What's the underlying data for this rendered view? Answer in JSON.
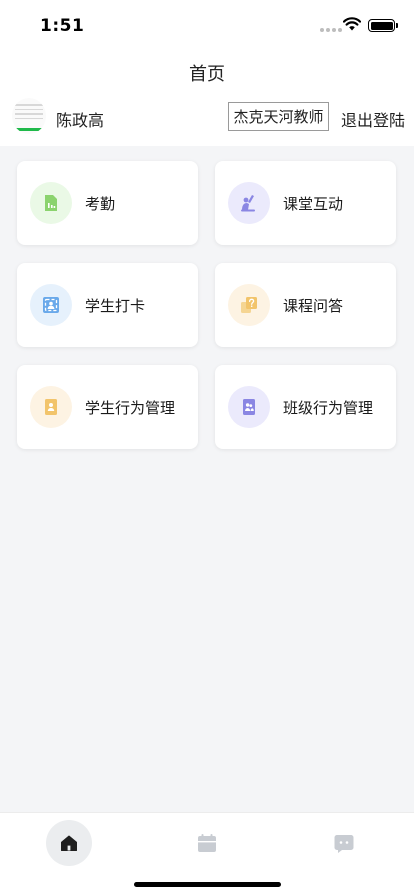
{
  "status": {
    "time": "1:51"
  },
  "nav": {
    "title": "首页"
  },
  "user": {
    "name": "陈政高",
    "school": "杰克天河教师",
    "logout": "退出登陆"
  },
  "menu": [
    {
      "label": "考勤",
      "icon": "chart-doc-icon",
      "bg": "#eaf9e6",
      "color": "#8bd36e"
    },
    {
      "label": "课堂互动",
      "icon": "raise-hand-icon",
      "bg": "#ebeafc",
      "color": "#8a86e3"
    },
    {
      "label": "学生打卡",
      "icon": "scan-face-icon",
      "bg": "#e6f1fc",
      "color": "#6aa9ea"
    },
    {
      "label": "课程问答",
      "icon": "question-cards-icon",
      "bg": "#fdf3e3",
      "color": "#f2c46b"
    },
    {
      "label": "学生行为管理",
      "icon": "student-doc-icon",
      "bg": "#fdf3e3",
      "color": "#f2c46b"
    },
    {
      "label": "班级行为管理",
      "icon": "class-doc-icon",
      "bg": "#ebeafc",
      "color": "#8a86e3"
    }
  ],
  "tabs": [
    {
      "name": "home",
      "icon": "home-icon",
      "active": true
    },
    {
      "name": "calendar",
      "icon": "calendar-icon",
      "active": false
    },
    {
      "name": "message",
      "icon": "chat-icon",
      "active": false
    }
  ]
}
